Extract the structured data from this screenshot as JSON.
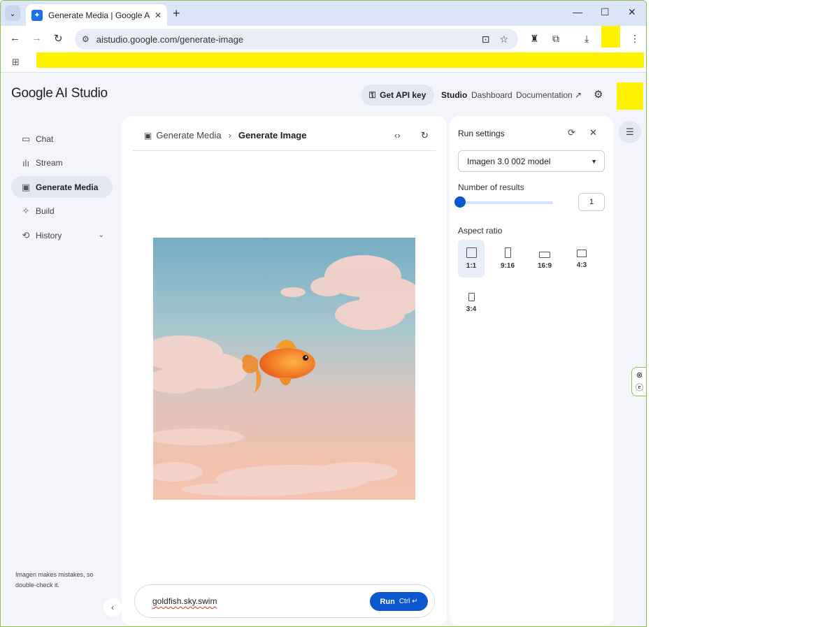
{
  "browser": {
    "tab_title": "Generate Media | Google AI Studio",
    "url": "aistudio.google.com/generate-image"
  },
  "app": {
    "logo_google": "Google",
    "logo_product": "AI Studio",
    "api_key_label": "Get API key",
    "nav": [
      "Studio",
      "Dashboard",
      "Documentation"
    ]
  },
  "sidebar": {
    "items": [
      {
        "label": "Chat",
        "icon": "chat-icon"
      },
      {
        "label": "Stream",
        "icon": "stream-icon"
      },
      {
        "label": "Generate Media",
        "icon": "media-icon",
        "active": true
      },
      {
        "label": "Build",
        "icon": "build-icon"
      },
      {
        "label": "History",
        "icon": "history-icon"
      }
    ],
    "disclaimer": "Imagen makes mistakes, so double-check it."
  },
  "main": {
    "breadcrumb_parent": "Generate Media",
    "breadcrumb_current": "Generate Image",
    "prompt_value": "goldfish.sky.swim",
    "run_label": "Run",
    "run_shortcut": "Ctrl ↵"
  },
  "settings": {
    "title": "Run settings",
    "model": "Imagen 3.0 002 model",
    "results_label": "Number of results",
    "results_value": "1",
    "aspect_label": "Aspect ratio",
    "aspect_options": [
      "1:1",
      "9:16",
      "16:9",
      "4:3",
      "3:4"
    ],
    "aspect_selected": "1:1"
  },
  "colors": {
    "accent": "#0b57d0",
    "redaction": "#fff200"
  }
}
